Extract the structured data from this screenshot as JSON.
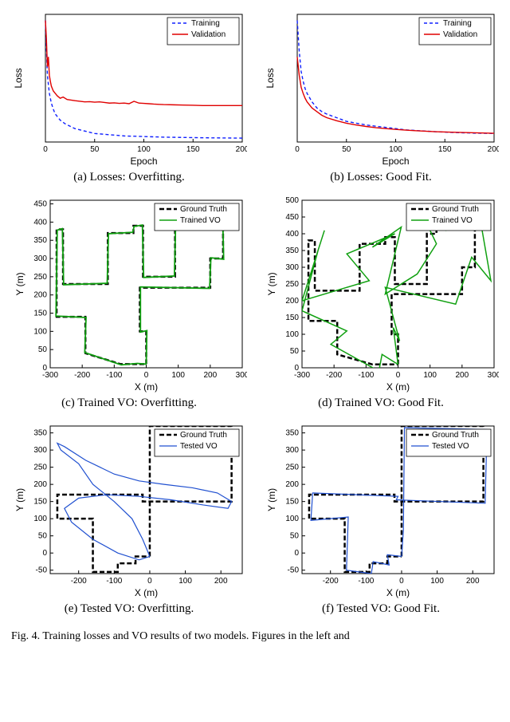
{
  "panels": {
    "a": {
      "caption": "(a) Losses: Overfitting.",
      "xlabel": "Epoch",
      "ylabel": "Loss"
    },
    "b": {
      "caption": "(b) Losses: Good Fit.",
      "xlabel": "Epoch",
      "ylabel": "Loss"
    },
    "c": {
      "caption": "(c) Trained VO: Overfitting.",
      "xlabel": "X (m)",
      "ylabel": "Y (m)"
    },
    "d": {
      "caption": "(d) Trained VO: Good Fit.",
      "xlabel": "X (m)",
      "ylabel": "Y (m)"
    },
    "e": {
      "caption": "(e) Tested VO: Overfitting.",
      "xlabel": "X (m)",
      "ylabel": "Y (m)"
    },
    "f": {
      "caption": "(f) Tested VO: Good Fit.",
      "xlabel": "X (m)",
      "ylabel": "Y (m)"
    }
  },
  "legends": {
    "loss": [
      {
        "label": "Training",
        "color": "#1020ff",
        "dash": "4,3"
      },
      {
        "label": "Validation",
        "color": "#e00000",
        "dash": ""
      }
    ],
    "trained": [
      {
        "label": "Ground Truth",
        "color": "#000000",
        "dash": "6,3",
        "width": 2.5
      },
      {
        "label": "Trained VO",
        "color": "#10a010",
        "dash": "",
        "width": 1.5
      }
    ],
    "tested": [
      {
        "label": "Ground Truth",
        "color": "#000000",
        "dash": "6,3",
        "width": 2.5
      },
      {
        "label": "Tested VO",
        "color": "#2050d0",
        "dash": "",
        "width": 1.2
      }
    ]
  },
  "chart_data": [
    {
      "id": "a",
      "type": "line",
      "xlim": [
        0,
        200
      ],
      "xticks": [
        0,
        50,
        100,
        150,
        200
      ],
      "series": [
        {
          "name": "Training",
          "color": "#1020ff",
          "dash": "4,3",
          "x": [
            0,
            2,
            4,
            6,
            8,
            10,
            15,
            20,
            30,
            50,
            80,
            120,
            160,
            200
          ],
          "y": [
            1.0,
            0.55,
            0.4,
            0.32,
            0.27,
            0.23,
            0.18,
            0.15,
            0.11,
            0.07,
            0.05,
            0.04,
            0.035,
            0.032
          ]
        },
        {
          "name": "Validation",
          "color": "#e00000",
          "dash": "",
          "x": [
            0,
            1,
            2,
            3,
            4,
            5,
            6,
            8,
            10,
            12,
            15,
            18,
            22,
            26,
            30,
            35,
            40,
            45,
            50,
            55,
            60,
            65,
            70,
            75,
            80,
            85,
            90,
            95,
            100,
            105,
            110,
            115,
            120,
            130,
            140,
            150,
            160,
            170,
            180,
            190,
            200
          ],
          "y": [
            1.0,
            0.85,
            0.62,
            0.7,
            0.55,
            0.5,
            0.46,
            0.42,
            0.4,
            0.38,
            0.36,
            0.37,
            0.35,
            0.345,
            0.34,
            0.335,
            0.33,
            0.332,
            0.328,
            0.33,
            0.325,
            0.32,
            0.322,
            0.318,
            0.32,
            0.315,
            0.335,
            0.32,
            0.318,
            0.315,
            0.312,
            0.31,
            0.308,
            0.306,
            0.304,
            0.302,
            0.3,
            0.3,
            0.3,
            0.3,
            0.3
          ]
        }
      ]
    },
    {
      "id": "b",
      "type": "line",
      "xlim": [
        0,
        200
      ],
      "xticks": [
        0,
        50,
        100,
        150,
        200
      ],
      "series": [
        {
          "name": "Training",
          "color": "#1020ff",
          "dash": "4,3",
          "x": [
            0,
            2,
            4,
            6,
            8,
            10,
            15,
            20,
            25,
            30,
            40,
            50,
            60,
            70,
            80,
            90,
            100,
            110,
            120,
            140,
            160,
            180,
            200
          ],
          "y": [
            1.0,
            0.75,
            0.58,
            0.5,
            0.44,
            0.4,
            0.33,
            0.28,
            0.25,
            0.23,
            0.2,
            0.17,
            0.155,
            0.14,
            0.13,
            0.12,
            0.11,
            0.1,
            0.095,
            0.085,
            0.078,
            0.073,
            0.07
          ]
        },
        {
          "name": "Validation",
          "color": "#e00000",
          "dash": "",
          "x": [
            0,
            2,
            4,
            6,
            8,
            10,
            15,
            20,
            25,
            30,
            40,
            50,
            60,
            70,
            80,
            90,
            100,
            110,
            120,
            140,
            160,
            180,
            200
          ],
          "y": [
            0.7,
            0.55,
            0.45,
            0.4,
            0.36,
            0.33,
            0.28,
            0.25,
            0.22,
            0.2,
            0.175,
            0.155,
            0.14,
            0.128,
            0.118,
            0.11,
            0.104,
            0.098,
            0.093,
            0.085,
            0.08,
            0.076,
            0.072
          ]
        }
      ]
    },
    {
      "id": "c",
      "type": "line",
      "xlim": [
        -300,
        300
      ],
      "ylim": [
        0,
        460
      ],
      "xticks": [
        -300,
        -200,
        -100,
        0,
        100,
        200,
        300
      ],
      "yticks": [
        0,
        50,
        100,
        150,
        200,
        250,
        300,
        350,
        400,
        450
      ],
      "series": [
        {
          "name": "Ground Truth",
          "color": "#000000",
          "dash": "6,3",
          "width": 2.5,
          "x": [
            0,
            0,
            -20,
            -20,
            200,
            200,
            240,
            240,
            120,
            120,
            90,
            90,
            -10,
            -10,
            -40,
            -40,
            -120,
            -120,
            -260,
            -260,
            -280,
            -280,
            -190,
            -190,
            -80,
            -30,
            0
          ],
          "y": [
            10,
            100,
            100,
            220,
            220,
            300,
            300,
            440,
            440,
            400,
            400,
            250,
            250,
            390,
            390,
            370,
            370,
            230,
            230,
            380,
            380,
            140,
            140,
            40,
            10,
            10,
            10
          ]
        },
        {
          "name": "Trained VO",
          "color": "#10a010",
          "dash": "",
          "width": 1.8,
          "x": [
            0,
            2,
            -18,
            -18,
            198,
            202,
            242,
            238,
            122,
            118,
            92,
            88,
            -8,
            -12,
            -38,
            -42,
            -118,
            -122,
            -258,
            -262,
            -278,
            -282,
            -188,
            -192,
            -78,
            -28,
            0
          ],
          "y": [
            10,
            102,
            98,
            222,
            218,
            302,
            298,
            442,
            438,
            402,
            398,
            252,
            248,
            392,
            388,
            372,
            368,
            232,
            228,
            382,
            378,
            142,
            138,
            42,
            8,
            12,
            10
          ]
        }
      ]
    },
    {
      "id": "d",
      "type": "line",
      "xlim": [
        -300,
        300
      ],
      "ylim": [
        0,
        500
      ],
      "xticks": [
        -300,
        -200,
        -100,
        0,
        100,
        200,
        300
      ],
      "yticks": [
        0,
        50,
        100,
        150,
        200,
        250,
        300,
        350,
        400,
        450,
        500
      ],
      "series": [
        {
          "name": "Ground Truth",
          "color": "#000000",
          "dash": "6,3",
          "width": 2.5,
          "x": [
            0,
            0,
            -20,
            -20,
            200,
            200,
            240,
            240,
            120,
            120,
            90,
            90,
            -10,
            -10,
            -40,
            -40,
            -120,
            -120,
            -260,
            -260,
            -280,
            -280,
            -190,
            -190,
            -80,
            -30,
            0
          ],
          "y": [
            10,
            100,
            100,
            220,
            220,
            300,
            300,
            440,
            440,
            400,
            400,
            250,
            250,
            390,
            390,
            370,
            370,
            230,
            230,
            380,
            380,
            140,
            140,
            40,
            10,
            10,
            10
          ]
        },
        {
          "name": "Trained VO",
          "color": "#10a010",
          "dash": "",
          "width": 1.5,
          "x": [
            0,
            -15,
            5,
            -40,
            180,
            230,
            290,
            250,
            150,
            90,
            120,
            60,
            -40,
            10,
            -80,
            -10,
            -160,
            -90,
            -300,
            -230,
            -250,
            -300,
            -160,
            -210,
            -60,
            -50,
            0
          ],
          "y": [
            10,
            120,
            80,
            240,
            190,
            330,
            260,
            480,
            410,
            430,
            370,
            280,
            220,
            420,
            360,
            400,
            340,
            260,
            200,
            410,
            350,
            170,
            110,
            70,
            -10,
            40,
            10
          ]
        }
      ]
    },
    {
      "id": "e",
      "type": "line",
      "xlim": [
        -280,
        260
      ],
      "ylim": [
        -60,
        370
      ],
      "xticks": [
        -200,
        -100,
        0,
        100,
        200
      ],
      "yticks": [
        -50,
        0,
        50,
        100,
        150,
        200,
        250,
        300,
        350
      ],
      "series": [
        {
          "name": "Ground Truth",
          "color": "#000000",
          "dash": "6,3",
          "width": 2.5,
          "x": [
            0,
            0,
            0,
            230,
            230,
            -20,
            -20,
            -260,
            -260,
            -160,
            -160,
            -90,
            -90,
            -40,
            -40,
            0
          ],
          "y": [
            -10,
            60,
            370,
            370,
            150,
            150,
            170,
            170,
            100,
            100,
            -55,
            -55,
            -30,
            -30,
            -10,
            -10
          ]
        },
        {
          "name": "Tested VO",
          "color": "#2050d0",
          "dash": "",
          "width": 1.2,
          "x": [
            0,
            -20,
            -50,
            -100,
            -160,
            -200,
            -250,
            -260,
            -240,
            -180,
            -100,
            -30,
            40,
            120,
            190,
            230,
            220,
            150,
            60,
            -30,
            -120,
            -200,
            -240,
            -220,
            -160,
            -90,
            -30,
            0
          ],
          "y": [
            -10,
            40,
            100,
            150,
            200,
            260,
            300,
            320,
            310,
            270,
            230,
            210,
            200,
            190,
            175,
            150,
            130,
            140,
            155,
            165,
            170,
            160,
            130,
            90,
            40,
            0,
            -20,
            -10
          ]
        }
      ]
    },
    {
      "id": "f",
      "type": "line",
      "xlim": [
        -280,
        260
      ],
      "ylim": [
        -60,
        370
      ],
      "xticks": [
        -200,
        -100,
        0,
        100,
        200
      ],
      "yticks": [
        -50,
        0,
        50,
        100,
        150,
        200,
        250,
        300,
        350
      ],
      "series": [
        {
          "name": "Ground Truth",
          "color": "#000000",
          "dash": "6,3",
          "width": 2.5,
          "x": [
            0,
            0,
            0,
            230,
            230,
            -20,
            -20,
            -260,
            -260,
            -160,
            -160,
            -90,
            -90,
            -40,
            -40,
            0
          ],
          "y": [
            -10,
            60,
            370,
            370,
            150,
            150,
            170,
            170,
            100,
            100,
            -55,
            -55,
            -30,
            -30,
            -10,
            -10
          ]
        },
        {
          "name": "Tested VO",
          "color": "#2050d0",
          "dash": "",
          "width": 1.2,
          "x": [
            0,
            5,
            8,
            240,
            235,
            -15,
            -10,
            -250,
            -255,
            -150,
            -155,
            -85,
            -80,
            -35,
            -40,
            0
          ],
          "y": [
            -10,
            65,
            365,
            360,
            145,
            155,
            165,
            175,
            95,
            105,
            -50,
            -60,
            -25,
            -35,
            -5,
            -10
          ]
        }
      ]
    }
  ],
  "figure_caption": "Fig. 4.   Training losses and VO results of two models. Figures in the left and"
}
